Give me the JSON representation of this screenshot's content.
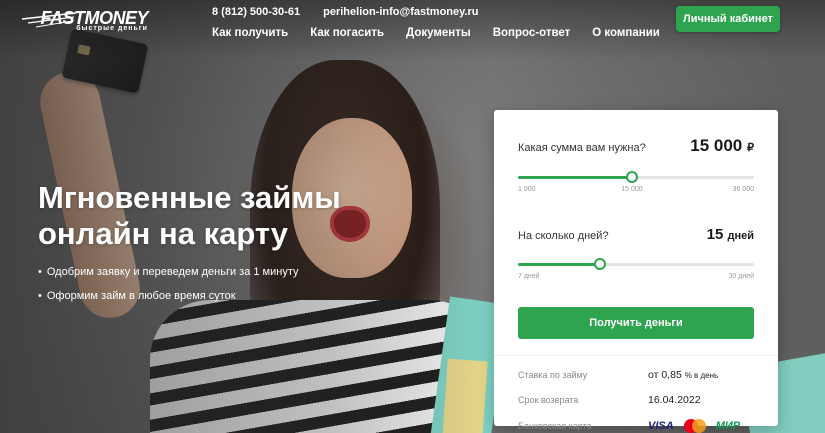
{
  "header": {
    "logo_main": "FASTMONEY",
    "logo_sub": "быстрые деньги",
    "phone": "8 (812) 500-30-61",
    "email": "perihelion-info@fastmoney.ru",
    "cabinet_button": "Личный кабинет",
    "nav": [
      "Как получить",
      "Как погасить",
      "Документы",
      "Вопрос-ответ",
      "О компании"
    ]
  },
  "hero": {
    "headline": "Мгновенные займы онлайн на карту",
    "bullets": [
      "Одобрим заявку и переведем деньги за 1 минуту",
      "Оформим займ в любое время суток"
    ]
  },
  "calculator": {
    "amount": {
      "label": "Какая сумма вам нужна?",
      "value": "15 000",
      "currency": "₽",
      "min_label": "1 000",
      "mid_label": "15 000",
      "max_label": "30 000",
      "min": 1000,
      "max": 30000,
      "current": 15000
    },
    "days": {
      "label": "На сколько дней?",
      "value": "15",
      "unit": "дней",
      "min_label": "7 дней",
      "max_label": "30 дней",
      "min": 7,
      "max": 30,
      "current": 15
    },
    "submit_button": "Получить деньги",
    "rate_key": "Ставка по займу",
    "rate_prefix": "от",
    "rate_value": "0,85",
    "rate_unit": "% в день",
    "due_key": "Срок возврата",
    "due_value": "16.04.2022",
    "card_key": "Банковская карта",
    "card_visa": "VISA",
    "card_mir": "МИР"
  },
  "colors": {
    "accent": "#2ea44f"
  }
}
